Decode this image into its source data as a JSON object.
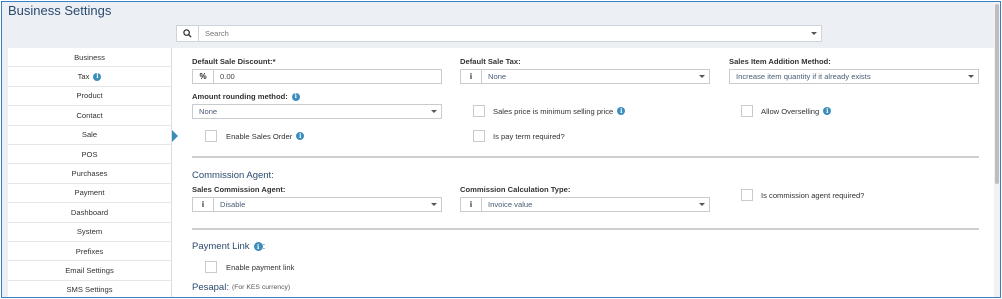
{
  "page": {
    "title": "Business Settings"
  },
  "search": {
    "placeholder": "Search"
  },
  "sidebar": {
    "items": [
      {
        "label": "Business"
      },
      {
        "label": "Tax",
        "info": "i"
      },
      {
        "label": "Product"
      },
      {
        "label": "Contact"
      },
      {
        "label": "Sale",
        "active": true
      },
      {
        "label": "POS"
      },
      {
        "label": "Purchases"
      },
      {
        "label": "Payment"
      },
      {
        "label": "Dashboard"
      },
      {
        "label": "System"
      },
      {
        "label": "Prefixes"
      },
      {
        "label": "Email Settings"
      },
      {
        "label": "SMS Settings"
      }
    ]
  },
  "sale": {
    "default_discount": {
      "label": "Default Sale Discount:*",
      "addon": "%",
      "value": "0.00"
    },
    "default_tax": {
      "label": "Default Sale Tax:",
      "addon": "i",
      "value": "None"
    },
    "item_addition": {
      "label": "Sales Item Addition Method:",
      "value": "Increase item quantity if it already exists"
    },
    "rounding": {
      "label": "Amount rounding method:",
      "info": "i",
      "value": "None"
    },
    "min_selling_price": {
      "label": "Sales price is minimum selling price",
      "info": "i"
    },
    "allow_overselling": {
      "label": "Allow Overselling",
      "info": "i"
    },
    "enable_sales_order": {
      "label": "Enable Sales Order",
      "info": "i"
    },
    "pay_term_required": {
      "label": "Is pay term required?"
    }
  },
  "commission": {
    "title": "Commission Agent:",
    "agent": {
      "label": "Sales Commission Agent:",
      "addon": "i",
      "value": "Disable"
    },
    "calc_type": {
      "label": "Commission Calculation Type:",
      "addon": "i",
      "value": "Invoice value"
    },
    "required": {
      "label": "Is commission agent required?"
    }
  },
  "payment_link": {
    "title": "Payment Link",
    "info": "i",
    "colon": ":",
    "enable": {
      "label": "Enable payment link"
    }
  },
  "pesapal": {
    "title": "Pesapal:",
    "note": "(For KES currency)"
  },
  "colors": {
    "accent": "#3c8dbc",
    "title": "#2b4a6f",
    "frame": "#3a7fc4",
    "background": "#ecf0f5"
  }
}
